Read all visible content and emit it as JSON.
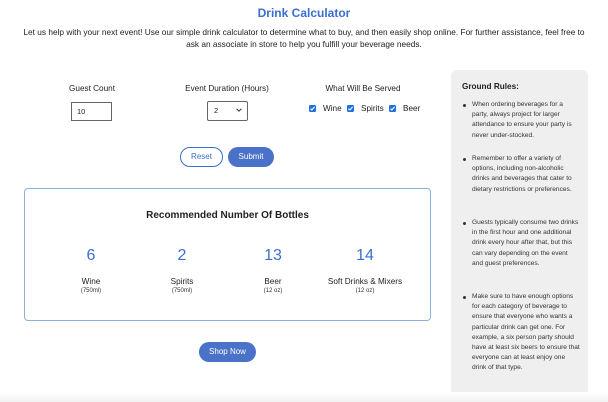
{
  "header": {
    "title": "Drink Calculator",
    "intro": "Let us help with your next event! Use our simple drink calculator to determine what to buy, and then easily shop online. For further assistance, feel free to ask an associate in store to help you fulfill your beverage needs."
  },
  "form": {
    "guest_count_label": "Guest Count",
    "guest_count_value": "10",
    "duration_label": "Event Duration (Hours)",
    "duration_value": "2",
    "served_label": "What Will Be Served",
    "served_options": [
      {
        "label": "Wine",
        "checked": true
      },
      {
        "label": "Spirits",
        "checked": true
      },
      {
        "label": "Beer",
        "checked": true
      }
    ],
    "reset_label": "Reset",
    "submit_label": "Submit"
  },
  "results": {
    "title": "Recommended Number Of Bottles",
    "items": [
      {
        "count": "6",
        "name": "Wine",
        "unit": "(750ml)"
      },
      {
        "count": "2",
        "name": "Spirits",
        "unit": "(750ml)"
      },
      {
        "count": "13",
        "name": "Beer",
        "unit": "(12 oz)"
      },
      {
        "count": "14",
        "name": "Soft Drinks & Mixers",
        "unit": "(12 oz)"
      }
    ],
    "shop_label": "Shop Now"
  },
  "sidebar": {
    "title": "Ground Rules:",
    "rules": [
      "When ordering beverages for a party, always project for larger attendance to ensure your party is never under-stocked.",
      "Remember to offer a variety of options, including non-alcoholic drinks and beverages that cater to dietary restrictions or preferences.",
      "Guests typically consume two drinks in the first hour and one additional drink every hour after that, but this can vary depending on the event and guest preferences.",
      "Make sure to have enough options for each category of beverage to ensure that everyone who wants a particular drink can get one. For example, a six person party should have at least six beers to ensure that everyone can at least enjoy one drink of that type."
    ]
  },
  "colors": {
    "accent": "#3a6fd0",
    "button": "#4a72c9",
    "checkbox": "#1e6fe0",
    "sidebar_bg": "#efefef"
  },
  "icons": {
    "select_arrow": "chevron-down-icon",
    "checkbox": "check-icon"
  }
}
